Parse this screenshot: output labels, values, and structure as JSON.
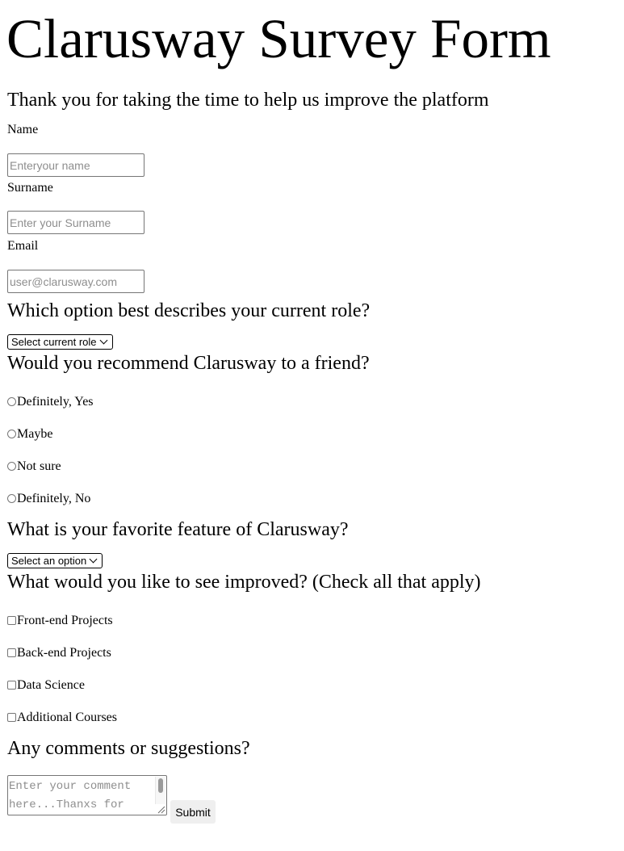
{
  "page": {
    "title": "Clarusway Survey Form",
    "subtitle": "Thank you for taking the time to help us improve the platform"
  },
  "form": {
    "name": {
      "label": "Name",
      "placeholder": "Enteryour name"
    },
    "surname": {
      "label": "Surname",
      "placeholder": "Enter your Surname"
    },
    "email": {
      "label": "Email",
      "placeholder": "user@clarusway.com"
    },
    "role": {
      "question": "Which option best describes your current role?",
      "selected": "Select current role"
    },
    "recommend": {
      "question": "Would you recommend Clarusway to a friend?",
      "options": [
        "Definitely, Yes",
        "Maybe",
        "Not sure",
        "Definitely, No"
      ]
    },
    "feature": {
      "question": "What is your favorite feature of Clarusway?",
      "selected": "Select an option"
    },
    "improve": {
      "question": "What would you like to see improved? (Check all that apply)",
      "options": [
        "Front-end Projects",
        "Back-end Projects",
        "Data Science",
        "Additional Courses"
      ]
    },
    "comments": {
      "question": "Any comments or suggestions?",
      "placeholder": "Enter your comment here...Thanxs for"
    },
    "submit_label": "Submit"
  },
  "icons": {
    "select_arrow": "chevron-down-icon",
    "textarea_grip": "resize-grip-icon"
  },
  "colors": {
    "placeholder": "#8e8e8e",
    "input_border": "#767676",
    "button_bg": "#efefef"
  }
}
